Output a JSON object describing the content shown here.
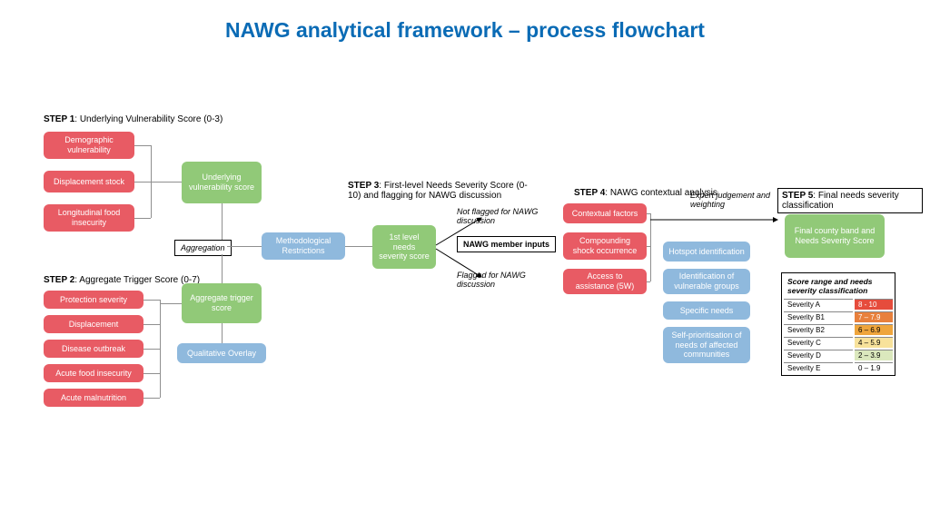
{
  "title": "NAWG analytical framework – process flowchart",
  "step1": {
    "label_strong": "STEP 1",
    "label_rest": ": Underlying Vulnerability Score (0-3)",
    "inputs": [
      "Demographic vulnerability",
      "Displacement stock",
      "Longitudinal food insecurity"
    ],
    "output": "Underlying vulnerability score"
  },
  "aggregation_label": "Aggregation",
  "methodological": "Methodological Restrictions",
  "step2": {
    "label_strong": "STEP 2",
    "label_rest": ": Aggregate Trigger Score (0-7)",
    "inputs": [
      "Protection severity",
      "Displacement",
      "Disease outbreak",
      "Acute food insecurity",
      "Acute malnutrition"
    ],
    "output": "Aggregate trigger score",
    "overlay": "Qualitative Overlay"
  },
  "step3": {
    "label_strong": "STEP 3",
    "label_rest": ": First-level Needs Severity Score (0-10) and flagging for NAWG discussion",
    "box": "1st level needs severity score",
    "not_flagged": "Not flagged for NAWG discussion",
    "member_inputs": "NAWG member inputs",
    "flagged": "Flagged for NAWG discussion"
  },
  "step4": {
    "label_strong": "STEP 4",
    "label_rest": ": NAWG contextual analysis",
    "red_boxes": [
      "Contextual factors",
      "Compounding shock occurrence",
      "Access to assistance (5W)"
    ],
    "judgement": "Expert judgement and weighting",
    "blue_boxes": [
      "Hotspot identification",
      "Identification of vulnerable groups",
      "Specific needs",
      "Self-prioritisation of needs of affected communities"
    ]
  },
  "step5": {
    "label_strong": "STEP 5",
    "label_rest": ": Final needs severity classification",
    "box": "Final county band and Needs Severity Score"
  },
  "legend": {
    "header": "Score range and needs severity classification",
    "rows": [
      {
        "label": "Severity A",
        "range": "8 - 10",
        "cls": "sevA"
      },
      {
        "label": "Severity B1",
        "range": "7 – 7.9",
        "cls": "sevB1"
      },
      {
        "label": "Severity B2",
        "range": "6 – 6.9",
        "cls": "sevB2"
      },
      {
        "label": "Severity C",
        "range": "4 – 5.9",
        "cls": "sevC"
      },
      {
        "label": "Severity D",
        "range": "2 – 3.9",
        "cls": "sevD"
      },
      {
        "label": "Severity E",
        "range": "0 – 1.9",
        "cls": "sevE"
      }
    ]
  }
}
